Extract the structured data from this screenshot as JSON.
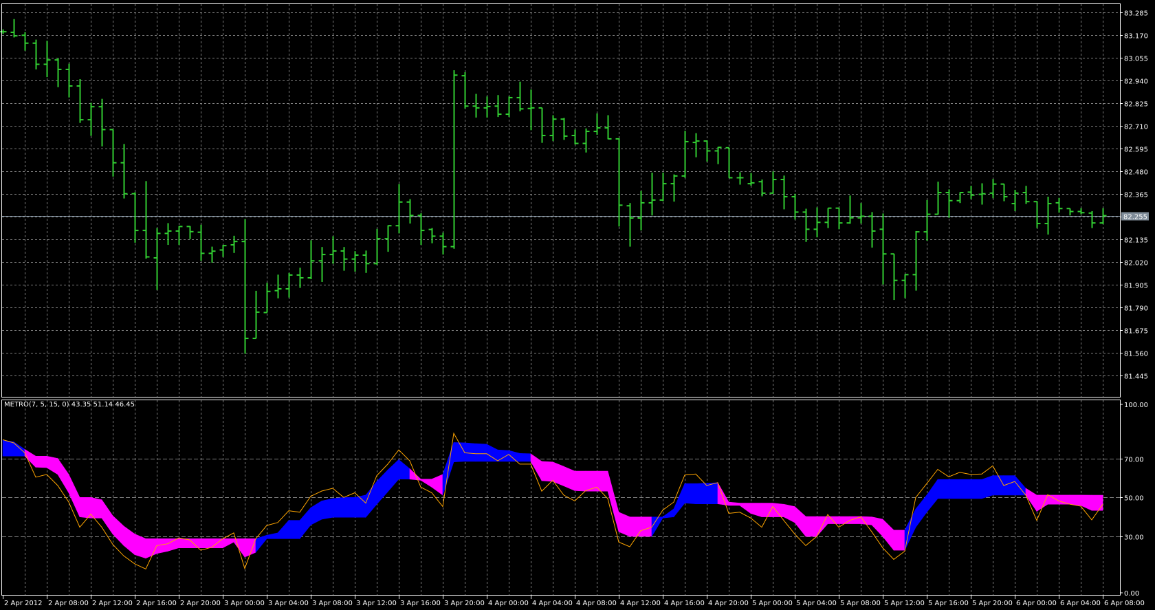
{
  "indicator_title": "METRO(7, 5, 15, 0) 43.35 51.14 46.45",
  "current_price_label": "82.255",
  "colors": {
    "bars": "#32CD32",
    "up_band": "#0000FF",
    "down_band": "#FF00FF",
    "line": "#FFA500",
    "grid": "#808080",
    "axis": "#FFFFFF",
    "price_tag": "#7F8C99"
  },
  "chart_data": [
    {
      "type": "ohlc",
      "title": "Price",
      "current_price": 82.255,
      "ylim": [
        81.4,
        83.31
      ],
      "y_ticks": [
        "83.285",
        "83.170",
        "83.055",
        "82.940",
        "82.825",
        "82.710",
        "82.595",
        "82.480",
        "82.365",
        "82.250",
        "82.135",
        "82.020",
        "81.905",
        "81.790",
        "81.675",
        "81.560",
        "81.445"
      ],
      "y_tick_values": [
        83.285,
        83.17,
        83.055,
        82.94,
        82.825,
        82.71,
        82.595,
        82.48,
        82.365,
        82.25,
        82.135,
        82.02,
        81.905,
        81.79,
        81.675,
        81.56,
        81.445
      ],
      "x_ticks": [
        "2 Apr 2012",
        "2 Apr 08:00",
        "2 Apr 12:00",
        "2 Apr 16:00",
        "2 Apr 20:00",
        "3 Apr 00:00",
        "3 Apr 04:00",
        "3 Apr 08:00",
        "3 Apr 12:00",
        "3 Apr 16:00",
        "3 Apr 20:00",
        "4 Apr 00:00",
        "4 Apr 04:00",
        "4 Apr 08:00",
        "4 Apr 12:00",
        "4 Apr 16:00",
        "4 Apr 20:00",
        "5 Apr 00:00",
        "5 Apr 04:00",
        "5 Apr 08:00",
        "5 Apr 12:00",
        "5 Apr 16:00",
        "5 Apr 20:00",
        "6 Apr 00:00",
        "6 Apr 04:00",
        "6 Apr 08:00"
      ],
      "x_tick_every_bars": 4,
      "ohlc": [
        [
          83.187,
          83.199,
          83.176,
          83.187
        ],
        [
          83.184,
          83.251,
          83.158,
          83.166
        ],
        [
          83.169,
          83.185,
          83.091,
          83.129
        ],
        [
          83.129,
          83.147,
          82.996,
          83.022
        ],
        [
          83.022,
          83.141,
          82.957,
          83.044
        ],
        [
          83.044,
          83.054,
          82.906,
          82.996
        ],
        [
          82.996,
          83.025,
          82.854,
          82.912
        ],
        [
          82.912,
          82.947,
          82.725,
          82.741
        ],
        [
          82.741,
          82.827,
          82.659,
          82.807
        ],
        [
          82.807,
          82.847,
          82.606,
          82.691
        ],
        [
          82.691,
          82.691,
          82.453,
          82.523
        ],
        [
          82.523,
          82.618,
          82.342,
          82.366
        ],
        [
          82.366,
          82.374,
          82.118,
          82.18
        ],
        [
          82.18,
          82.43,
          82.037,
          82.046
        ],
        [
          82.041,
          82.192,
          81.878,
          82.165
        ],
        [
          82.165,
          82.217,
          82.107,
          82.177
        ],
        [
          82.177,
          82.202,
          82.107,
          82.2
        ],
        [
          82.2,
          82.202,
          82.136,
          82.174
        ],
        [
          82.171,
          82.209,
          82.026,
          82.064
        ],
        [
          82.064,
          82.098,
          82.017,
          82.075
        ],
        [
          82.081,
          82.107,
          82.045,
          82.103
        ],
        [
          82.107,
          82.153,
          82.066,
          82.124
        ],
        [
          82.124,
          82.237,
          81.555,
          81.633
        ],
        [
          81.633,
          81.874,
          81.633,
          81.766
        ],
        [
          81.764,
          81.915,
          81.764,
          81.871
        ],
        [
          81.875,
          81.956,
          81.836,
          81.884
        ],
        [
          81.884,
          81.965,
          81.84,
          81.954
        ],
        [
          81.954,
          81.991,
          81.889,
          81.94
        ],
        [
          81.94,
          82.13,
          81.933,
          82.026
        ],
        [
          82.026,
          82.096,
          81.919,
          82.058
        ],
        [
          82.058,
          82.151,
          82.011,
          82.076
        ],
        [
          82.076,
          82.096,
          81.976,
          82.035
        ],
        [
          82.035,
          82.075,
          81.971,
          82.055
        ],
        [
          82.055,
          82.078,
          81.965,
          82.012
        ],
        [
          82.012,
          82.188,
          82.006,
          82.138
        ],
        [
          82.138,
          82.206,
          82.072,
          82.204
        ],
        [
          82.204,
          82.415,
          82.165,
          82.324
        ],
        [
          82.324,
          82.339,
          82.215,
          82.256
        ],
        [
          82.256,
          82.267,
          82.107,
          82.18
        ],
        [
          82.185,
          82.192,
          82.115,
          82.151
        ],
        [
          82.151,
          82.169,
          82.058,
          82.098
        ],
        [
          82.098,
          82.992,
          82.087,
          82.967
        ],
        [
          82.964,
          82.982,
          82.798,
          82.81
        ],
        [
          82.81,
          82.872,
          82.752,
          82.801
        ],
        [
          82.801,
          82.859,
          82.752,
          82.808
        ],
        [
          82.81,
          82.866,
          82.755,
          82.769
        ],
        [
          82.769,
          82.859,
          82.755,
          82.853
        ],
        [
          82.853,
          82.934,
          82.784,
          82.796
        ],
        [
          82.798,
          82.894,
          82.688,
          82.801
        ],
        [
          82.801,
          82.801,
          82.624,
          82.661
        ],
        [
          82.661,
          82.764,
          82.633,
          82.744
        ],
        [
          82.744,
          82.75,
          82.639,
          82.658
        ],
        [
          82.661,
          82.691,
          82.616,
          82.621
        ],
        [
          82.621,
          82.697,
          82.575,
          82.682
        ],
        [
          82.682,
          82.773,
          82.665,
          82.7
        ],
        [
          82.7,
          82.764,
          82.642,
          82.644
        ],
        [
          82.644,
          82.647,
          82.2,
          82.308
        ],
        [
          82.305,
          82.319,
          82.098,
          82.243
        ],
        [
          82.243,
          82.38,
          82.18,
          82.32
        ],
        [
          82.32,
          82.473,
          82.256,
          82.334
        ],
        [
          82.334,
          82.473,
          82.328,
          82.417
        ],
        [
          82.417,
          82.464,
          82.326,
          82.456
        ],
        [
          82.456,
          82.685,
          82.446,
          82.63
        ],
        [
          82.626,
          82.673,
          82.551,
          82.633
        ],
        [
          82.633,
          82.636,
          82.529,
          82.583
        ],
        [
          82.583,
          82.603,
          82.516,
          82.601
        ],
        [
          82.599,
          82.599,
          82.446,
          82.447
        ],
        [
          82.447,
          82.475,
          82.412,
          82.447
        ],
        [
          82.417,
          82.471,
          82.407,
          82.421
        ],
        [
          82.427,
          82.438,
          82.353,
          82.369
        ],
        [
          82.369,
          82.479,
          82.366,
          82.438
        ],
        [
          82.438,
          82.458,
          82.287,
          82.351
        ],
        [
          82.351,
          82.366,
          82.235,
          82.273
        ],
        [
          82.273,
          82.29,
          82.122,
          82.186
        ],
        [
          82.186,
          82.297,
          82.145,
          82.221
        ],
        [
          82.221,
          82.293,
          82.192,
          82.293
        ],
        [
          82.293,
          82.293,
          82.186,
          82.218
        ],
        [
          82.218,
          82.357,
          82.214,
          82.244
        ],
        [
          82.244,
          82.319,
          82.215,
          82.252
        ],
        [
          82.252,
          82.273,
          82.093,
          82.177
        ],
        [
          82.186,
          82.266,
          81.906,
          82.061
        ],
        [
          82.061,
          82.061,
          81.828,
          81.927
        ],
        [
          81.927,
          81.958,
          81.838,
          81.956
        ],
        [
          81.956,
          82.177,
          81.875,
          82.173
        ],
        [
          82.173,
          82.334,
          82.128,
          82.262
        ],
        [
          82.262,
          82.427,
          82.261,
          82.372
        ],
        [
          82.372,
          82.388,
          82.244,
          82.331
        ],
        [
          82.331,
          82.374,
          82.319,
          82.372
        ],
        [
          82.374,
          82.406,
          82.339,
          82.359
        ],
        [
          82.363,
          82.419,
          82.311,
          82.366
        ],
        [
          82.369,
          82.441,
          82.343,
          82.415
        ],
        [
          82.415,
          82.415,
          82.328,
          82.351
        ],
        [
          82.316,
          82.386,
          82.278,
          82.369
        ],
        [
          82.372,
          82.406,
          82.314,
          82.326
        ],
        [
          82.326,
          82.328,
          82.192,
          82.215
        ],
        [
          82.215,
          82.351,
          82.159,
          82.316
        ],
        [
          82.32,
          82.345,
          82.27,
          82.291
        ],
        [
          82.291,
          82.291,
          82.256,
          82.276
        ],
        [
          82.276,
          82.293,
          82.262,
          82.27
        ],
        [
          82.268,
          82.278,
          82.192,
          82.218
        ],
        [
          82.218,
          82.293,
          82.212,
          82.255
        ]
      ]
    },
    {
      "type": "area",
      "title": "METRO(7, 5, 15, 0)",
      "ylim": [
        0,
        100
      ],
      "y_ticks": [
        "100.00",
        "70.00",
        "50.00",
        "30.00",
        "0.00"
      ],
      "y_tick_values": [
        100,
        70,
        50,
        30,
        0
      ],
      "legend_values": [
        43.35,
        51.14,
        46.45
      ],
      "band_upper": [
        79.4,
        78.5,
        74.7,
        71.2,
        71.2,
        70,
        61.8,
        50,
        50,
        48.8,
        40.6,
        35.3,
        31.2,
        28.8,
        28.8,
        28.8,
        28.8,
        28.8,
        28.8,
        28.8,
        28.8,
        28.8,
        28.8,
        28.8,
        30.6,
        31.8,
        38.2,
        38.2,
        44.7,
        48.2,
        49.4,
        50,
        50,
        51.2,
        58.2,
        64.1,
        69.4,
        64.7,
        59.4,
        59.4,
        61.8,
        78.2,
        78,
        77.6,
        77.3,
        74.4,
        74.1,
        72.6,
        72.4,
        68.5,
        68.2,
        65.9,
        63.5,
        63.5,
        63.5,
        63.5,
        42.4,
        40,
        40,
        40,
        40,
        44.1,
        57.1,
        57.1,
        57.3,
        57.6,
        47.6,
        47.1,
        47.1,
        47.1,
        47.1,
        46.5,
        45.3,
        40.2,
        40.2,
        40.2,
        40.2,
        40.2,
        40.2,
        40,
        38.8,
        33.2,
        33.2,
        44.1,
        51.2,
        59.2,
        59.2,
        59.2,
        59.2,
        59.2,
        61.2,
        61.2,
        61.2,
        54.7,
        51.2,
        51.2,
        51.2,
        51.2,
        51.2,
        51.14,
        51.14
      ],
      "band_lower": [
        71.2,
        71.2,
        71.2,
        65.5,
        65.3,
        61.8,
        52.4,
        40,
        39.4,
        39.4,
        31.2,
        25.3,
        20.6,
        18.8,
        21.2,
        22.4,
        24.1,
        24.1,
        24.1,
        24.1,
        24.1,
        27.1,
        19.4,
        21.8,
        28.8,
        28.8,
        28.8,
        28.8,
        35.9,
        38.8,
        39.8,
        39.8,
        39.8,
        39.8,
        46.5,
        52.9,
        59.4,
        59.4,
        58.8,
        55.3,
        51.2,
        68.2,
        68.5,
        68.5,
        68.5,
        68.5,
        68.5,
        68.5,
        68.5,
        58.6,
        58.2,
        55.9,
        53.5,
        53.2,
        53.2,
        53.2,
        32.4,
        30,
        30,
        30,
        39.4,
        40,
        47.1,
        46.7,
        46.7,
        46.7,
        45.9,
        45.9,
        41.8,
        40,
        40,
        40,
        37.1,
        30,
        30,
        36.5,
        36.5,
        36.5,
        36.5,
        35.9,
        30,
        22.9,
        22.9,
        34.7,
        42.4,
        49.4,
        49.4,
        49.4,
        49.4,
        49.4,
        51.2,
        51.2,
        51.2,
        51.2,
        42.9,
        46.5,
        46.5,
        46.5,
        45.9,
        43.35,
        43.35
      ],
      "trend": [
        "up",
        "up",
        "up",
        "down",
        "down",
        "down",
        "down",
        "down",
        "down",
        "down",
        "down",
        "down",
        "down",
        "down",
        "down",
        "down",
        "down",
        "down",
        "down",
        "down",
        "down",
        "down",
        "down",
        "down",
        "up",
        "up",
        "up",
        "up",
        "up",
        "up",
        "up",
        "up",
        "up",
        "up",
        "up",
        "up",
        "up",
        "up",
        "down",
        "down",
        "down",
        "up",
        "up",
        "up",
        "up",
        "up",
        "up",
        "up",
        "up",
        "down",
        "down",
        "down",
        "down",
        "down",
        "down",
        "down",
        "down",
        "down",
        "down",
        "down",
        "up",
        "up",
        "up",
        "up",
        "up",
        "up",
        "down",
        "down",
        "down",
        "down",
        "down",
        "down",
        "down",
        "down",
        "down",
        "down",
        "down",
        "down",
        "down",
        "down",
        "down",
        "down",
        "down",
        "up",
        "up",
        "up",
        "up",
        "up",
        "up",
        "up",
        "up",
        "up",
        "up",
        "up",
        "down",
        "down",
        "down",
        "down",
        "down",
        "down",
        "down"
      ],
      "line": [
        79.6,
        78,
        72.9,
        60.4,
        61.8,
        56.1,
        47.6,
        34.7,
        41.4,
        34.7,
        25.9,
        20,
        15.9,
        13.3,
        25.3,
        26.2,
        29.2,
        28.2,
        22.9,
        24.4,
        28.8,
        31.8,
        13.5,
        28.8,
        35.6,
        37.1,
        43.2,
        42.4,
        50.6,
        53.3,
        54.7,
        50,
        52.4,
        47.1,
        61.2,
        67.1,
        74.4,
        68.8,
        55.3,
        52.4,
        45.3,
        82.9,
        72.9,
        72.4,
        72.4,
        68.8,
        72.1,
        67.1,
        67.1,
        53.2,
        58.8,
        51.2,
        48.2,
        53.5,
        55.3,
        49.4,
        27.1,
        24.7,
        32.9,
        34.7,
        43.5,
        47.6,
        61.5,
        62,
        56.1,
        57.6,
        41.8,
        42.4,
        39.4,
        34.7,
        45.3,
        38.2,
        31.2,
        25.3,
        30,
        41.2,
        34.7,
        38.2,
        40,
        32.4,
        24.1,
        18.2,
        22.4,
        50,
        57.1,
        64.4,
        60.6,
        62.9,
        61.8,
        62,
        66.2,
        56.1,
        58.2,
        51.2,
        38.2,
        51.4,
        48.2,
        46.5,
        45.5,
        38.5,
        46.45
      ]
    }
  ]
}
